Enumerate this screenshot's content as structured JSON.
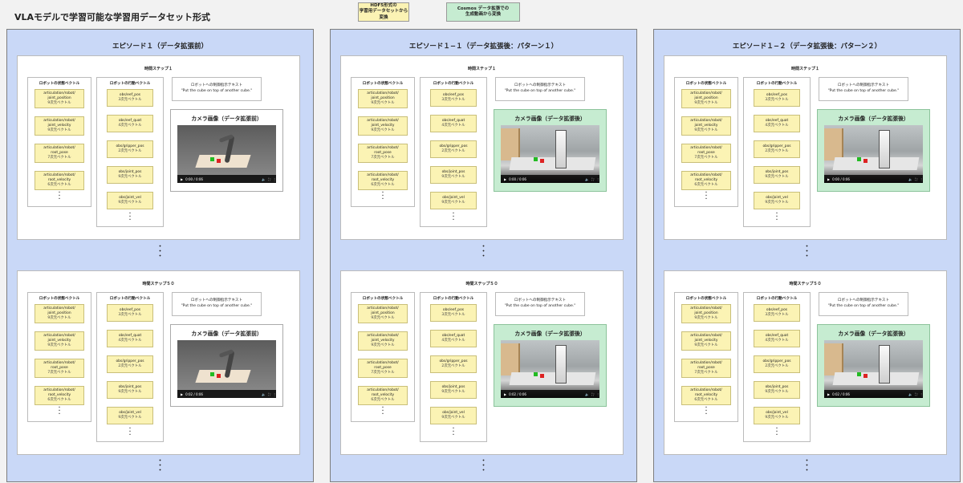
{
  "title": "VLAモデルで学習可能な学習用データセット形式",
  "legend": {
    "hdf5": [
      "HDF5形式の",
      "学習用データセットから変換"
    ],
    "cosmos": [
      "Cosmos データ拡張での",
      "生成動画から変換"
    ]
  },
  "labels": {
    "state_title": "ロボットの状態ベクトル",
    "action_title": "ロボットの行動ベクトル",
    "instr_title": "ロボットへの制御指示テキスト",
    "instr_text": "\"Put the cube on top of another cube.\"",
    "cam_before": "カメラ画像（データ拡張前）",
    "cam_after": "カメラ画像（データ拡張後）",
    "ellipsis": "・\n・\n・"
  },
  "state_vectors": [
    {
      "name": [
        "articulation/robot/",
        "joint_position"
      ],
      "dim": "9次元ベクトル"
    },
    {
      "name": [
        "articulation/robot/",
        "joint_velocity"
      ],
      "dim": "9次元ベクトル"
    },
    {
      "name": [
        "articulation/robot/",
        "root_pose"
      ],
      "dim": "7次元ベクトル"
    },
    {
      "name": [
        "articulation/robot/",
        "root_velocity"
      ],
      "dim": "6次元ベクトル"
    }
  ],
  "action_vectors": [
    {
      "name": "obs/eef_pos",
      "dim": "3次元ベクトル"
    },
    {
      "name": "obs/eef_quat",
      "dim": "4次元ベクトル"
    },
    {
      "name": "obs/gripper_pos",
      "dim": "2次元ベクトル"
    },
    {
      "name": "obs/joint_pos",
      "dim": "9次元ベクトル"
    },
    {
      "name": "obs/joint_vel",
      "dim": "9次元ベクトル"
    }
  ],
  "episodes": [
    {
      "title": "エピソード１（データ拡張前）",
      "augmented": false,
      "timesteps": [
        {
          "title": "時間ステップ１",
          "video_time": "0:00 / 0:06"
        },
        {
          "title": "時間ステップ５０",
          "video_time": "0:02 / 0:06"
        }
      ]
    },
    {
      "title": "エピソード１−１（データ拡張後：パターン１）",
      "augmented": true,
      "timesteps": [
        {
          "title": "時間ステップ１",
          "video_time": "0:00 / 0:06"
        },
        {
          "title": "時間ステップ５０",
          "video_time": "0:02 / 0:06"
        }
      ]
    },
    {
      "title": "エピソード１−２（データ拡張後：パターン２）",
      "augmented": true,
      "timesteps": [
        {
          "title": "時間ステップ１",
          "video_time": "0:00 / 0:06"
        },
        {
          "title": "時間ステップ５０",
          "video_time": "0:02 / 0:06"
        }
      ]
    }
  ],
  "video_controls": {
    "play": "▶",
    "volume": "🔈",
    "fullscreen": "⛶",
    "more": "⋮"
  }
}
